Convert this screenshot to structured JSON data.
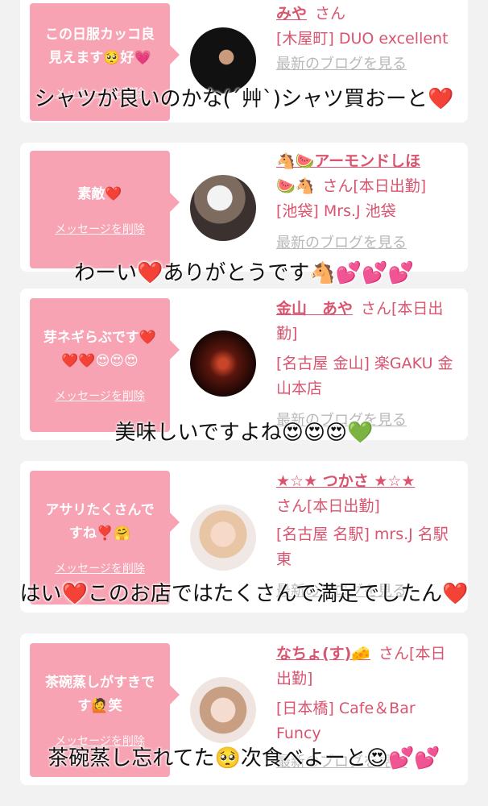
{
  "cards": [
    {
      "message": "この日服カッコ良\n見えます🥺好💗",
      "delete_label": "メッセージを削除",
      "cast_name": "みや",
      "san": "さん",
      "shop": "[木屋町] DUO excellent",
      "blog_label": "最新のブログを見る",
      "avatar_colors": [
        "#111111",
        "#222222"
      ]
    },
    {
      "message": "素敵❤️",
      "delete_label": "メッセージを削除",
      "cast_name": "🐴🍉アーモンドしほ",
      "name_suffix": "🍉🐴",
      "san": "さん[本日出勤]",
      "shop": "[池袋] Mrs.J 池袋",
      "blog_label": "最新のブログを見る",
      "avatar_colors": [
        "#8a8a8a",
        "#3a3a3a"
      ]
    },
    {
      "message": "芽ネギらぶです❤️\n❤️❤️😍😍😍",
      "delete_label": "メッセージを削除",
      "cast_name": "金山　あや",
      "san": "さん[本日出勤]",
      "shop": "[名古屋 金山] 楽GAKU 金山本店",
      "blog_label": "最新のブログを見る",
      "avatar_colors": [
        "#7a1e12",
        "#2a0c08"
      ]
    },
    {
      "message": "アサリたくさんで\nすね❣️🤗",
      "delete_label": "メッセージを削除",
      "cast_name": "★☆★ つかさ ★☆★",
      "san": "さん[本日出勤]",
      "shop": "[名古屋 名駅] mrs.J 名駅東",
      "blog_label": "最新のブログを見る",
      "avatar_colors": [
        "#f3e6dc",
        "#d9b9a6"
      ]
    },
    {
      "message": "茶碗蒸しがすきで\nす🙋笑",
      "delete_label": "メッセージを削除",
      "cast_name": "なちょ(す)🧀",
      "san": "さん[本日出勤]",
      "shop": "[日本橋] Cafe＆Bar Funcy",
      "blog_label": "最新のブログを見る",
      "avatar_colors": [
        "#e9d3c6",
        "#b98c78"
      ]
    }
  ],
  "captions": [
    "シャツが良いのかな(´艸`)シャツ買おーと❤️",
    "わーい❤️ありがとうです🐴💕💕💕",
    "美味しいですよね😍😍😍💚",
    "はい❤️このお店ではたくさんで満足でしたん❤️",
    "茶碗蒸し忘れてた🥺次食べよーと😍💕💕"
  ]
}
